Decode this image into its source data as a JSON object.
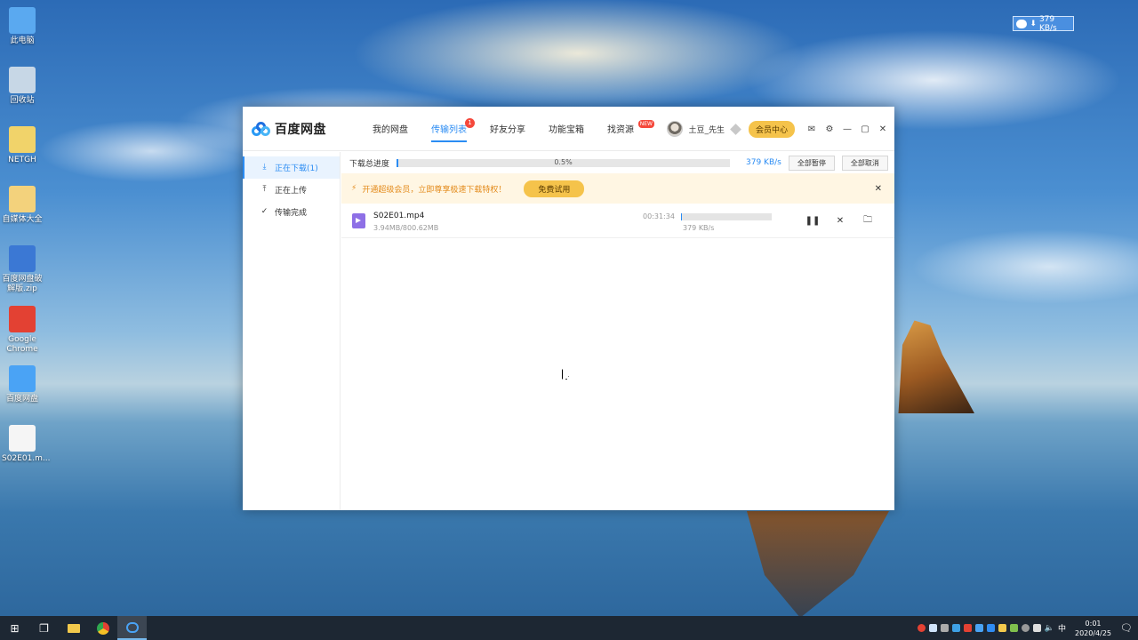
{
  "desktop": {
    "icons": [
      {
        "label": "此电脑",
        "icon": "computer-icon",
        "color": "#5aa9f0"
      },
      {
        "label": "回收站",
        "icon": "recycle-bin-icon",
        "color": "#c7d7e6"
      },
      {
        "label": "NETGH",
        "icon": "file-icon",
        "color": "#f1d36a"
      },
      {
        "label": "自媒体大全",
        "icon": "folder-icon",
        "color": "#f3d27c"
      },
      {
        "label": "百度网盘破解版.zip",
        "icon": "archive-icon",
        "color": "#3b78d4"
      },
      {
        "label": "Google Chrome",
        "icon": "chrome-icon",
        "color": "#e34133"
      },
      {
        "label": "百度网盘",
        "icon": "baidu-netdisk-icon",
        "color": "#4aa3f5"
      },
      {
        "label": "S02E01.m...",
        "icon": "blank-file-icon",
        "color": "#f5f5f5"
      }
    ]
  },
  "tray_widget": {
    "speed": "379 KB/s"
  },
  "app": {
    "logo_text": "百度网盘",
    "nav": [
      {
        "label": "我的网盘",
        "active": false
      },
      {
        "label": "传输列表",
        "active": true,
        "badge": "1"
      },
      {
        "label": "好友分享",
        "active": false
      },
      {
        "label": "功能宝箱",
        "active": false
      },
      {
        "label": "找资源",
        "active": false,
        "tag": "NEW"
      }
    ],
    "user": {
      "name": "土豆_先生"
    },
    "vip_label": "会员中心",
    "sidebar": [
      {
        "label": "正在下载(1)",
        "active": true,
        "icon": "download-icon"
      },
      {
        "label": "正在上传",
        "active": false,
        "icon": "upload-icon"
      },
      {
        "label": "传输完成",
        "active": false,
        "icon": "check-circle-icon"
      }
    ],
    "overall": {
      "label": "下载总进度",
      "percent_text": "0.5%",
      "percent": 0.005,
      "speed": "379 KB/s",
      "pause_all": "全部暂停",
      "cancel_all": "全部取消"
    },
    "promo": {
      "text": "开通超级会员，立即尊享极速下载特权！",
      "button": "免费试用"
    },
    "task": {
      "filename": "S02E01.mp4",
      "size": "3.94MB/800.62MB",
      "remaining": "00:31:34",
      "speed": "379 KB/s",
      "progress": 0.005
    }
  },
  "taskbar": {
    "time": "0:01",
    "date": "2020/4/25",
    "ime": "中"
  }
}
